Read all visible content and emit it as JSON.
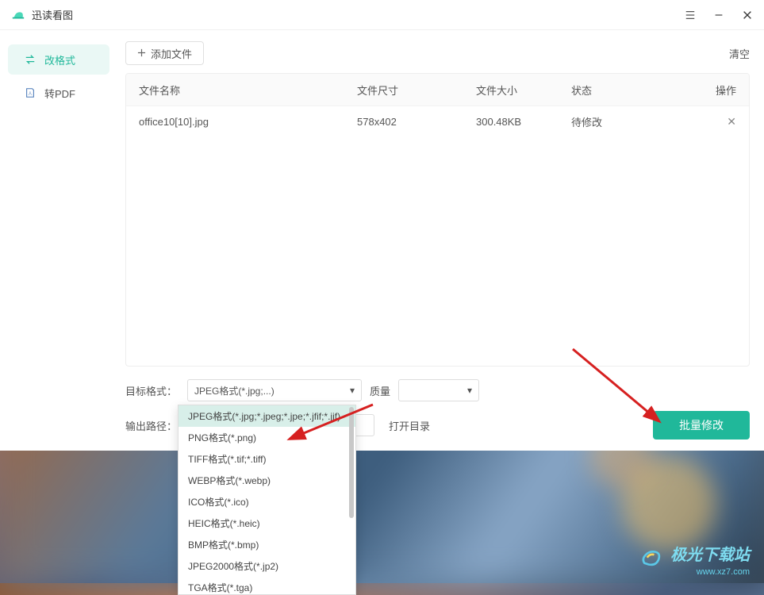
{
  "app": {
    "title": "迅读看图"
  },
  "sidebar": {
    "items": [
      {
        "label": "改格式"
      },
      {
        "label": "转PDF"
      }
    ]
  },
  "toolbar": {
    "add_label": "添加文件",
    "clear_label": "清空"
  },
  "table": {
    "headers": {
      "name": "文件名称",
      "dim": "文件尺寸",
      "size": "文件大小",
      "status": "状态",
      "action": "操作"
    },
    "rows": [
      {
        "name": "office10[10].jpg",
        "dim": "578x402",
        "size": "300.48KB",
        "status": "待修改"
      }
    ]
  },
  "bottom": {
    "target_label": "目标格式：",
    "target_value": "JPEG格式(*.jpg;...)",
    "quality_label": "质量",
    "output_label": "输出路径：",
    "output_path": "",
    "open_label": "打开目录",
    "batch_label": "批量修改"
  },
  "dropdown": {
    "options": [
      "JPEG格式(*.jpg;*.jpeg;*.jpe;*.jfif;*.jif)",
      "PNG格式(*.png)",
      "TIFF格式(*.tif;*.tiff)",
      "WEBP格式(*.webp)",
      "ICO格式(*.ico)",
      "HEIC格式(*.heic)",
      "BMP格式(*.bmp)",
      "JPEG2000格式(*.jp2)",
      "TGA格式(*.tga)"
    ]
  },
  "watermark": {
    "text": "极光下载站",
    "url": "www.xz7.com"
  }
}
